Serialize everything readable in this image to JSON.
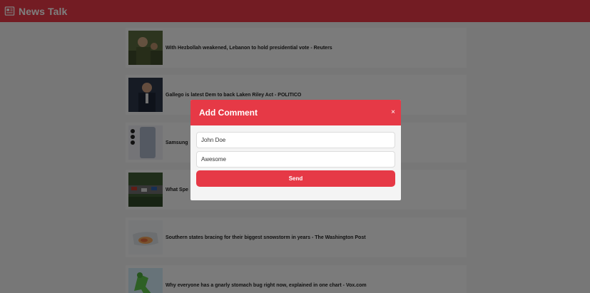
{
  "header": {
    "title": "News Talk",
    "icon": "newspaper-icon",
    "bg": "#e63946"
  },
  "feed": {
    "items": [
      {
        "headline": "With Hezbollah weakened, Lebanon to hold presidential vote - Reuters",
        "thumb": "photo-soldiers"
      },
      {
        "headline": "Gallego is latest Dem to back Laken Riley Act - POLITICO",
        "thumb": "photo-politician"
      },
      {
        "headline": "Samsung",
        "thumb": "photo-phone"
      },
      {
        "headline": "What Spe",
        "thumb": "photo-race"
      },
      {
        "headline": "Southern states bracing for their biggest snowstorm in years - The Washington Post",
        "thumb": "photo-map"
      },
      {
        "headline": "Why everyone has a gnarly stomach bug right now, explained in one chart - Vox.com",
        "thumb": "photo-figure"
      }
    ]
  },
  "modal": {
    "title": "Add Comment",
    "close_label": "×",
    "name_value": "John Doe",
    "comment_value": "Awesome",
    "send_label": "Send",
    "accent": "#e63946"
  }
}
